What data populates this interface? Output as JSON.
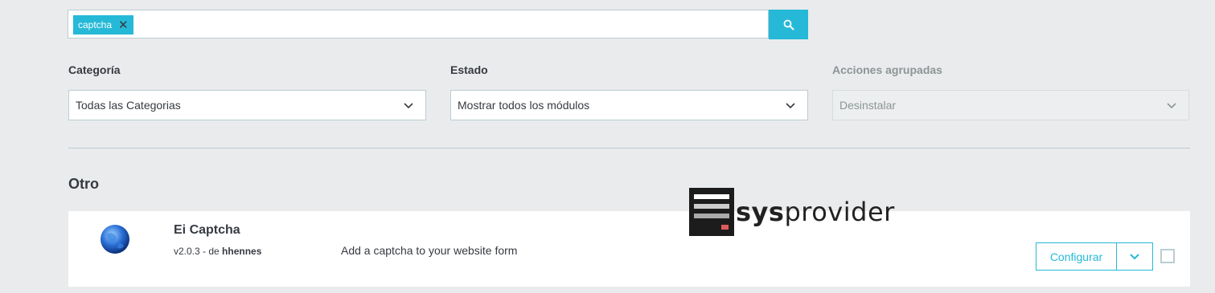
{
  "search": {
    "tag_label": "captcha",
    "tag_remove_glyph": "✕",
    "search_button_icon": "search-icon"
  },
  "filters": [
    {
      "label": "Categoría",
      "selected": "Todas las Categorias",
      "disabled": false
    },
    {
      "label": "Estado",
      "selected": "Mostrar todos los módulos",
      "disabled": false
    },
    {
      "label": "Acciones agrupadas",
      "selected": "Desinstalar",
      "disabled": true
    }
  ],
  "section": {
    "title": "Otro"
  },
  "module": {
    "icon": "globe-icon",
    "name": "Ei Captcha",
    "version": "v2.0.3 - de",
    "author": "hhennes",
    "description": "Add a captcha to your website form",
    "configure_label": "Configurar",
    "dropdown_icon": "chevron-down-icon",
    "checked": false
  },
  "watermark": {
    "bold": "sys",
    "regular": "provider"
  },
  "colors": {
    "accent": "#25b9d7",
    "background": "#eaebed",
    "text": "#363a41",
    "muted": "#8c9596"
  }
}
